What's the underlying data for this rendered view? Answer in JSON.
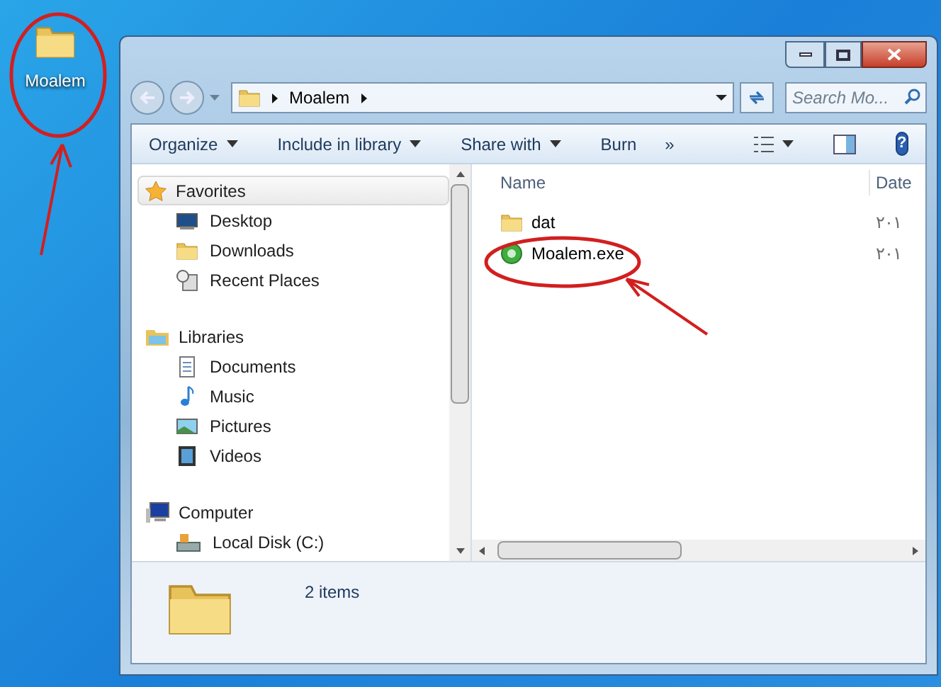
{
  "desktop_icons": [
    {
      "label": "Moalem",
      "kind": "folder"
    }
  ],
  "window": {
    "address": {
      "crumbs": [
        "Moalem"
      ]
    },
    "search": {
      "placeholder": "Search Mo..."
    },
    "toolbar": [
      {
        "label": "Organize",
        "dropdown": true
      },
      {
        "label": "Include in library",
        "dropdown": true
      },
      {
        "label": "Share with",
        "dropdown": true
      },
      {
        "label": "Burn",
        "dropdown": false
      }
    ],
    "toolbar_overflow": "»",
    "help": "?",
    "navigation": [
      {
        "label": "Favorites",
        "kind": "favorites",
        "selected": true,
        "children": [
          {
            "label": "Desktop",
            "kind": "desktop"
          },
          {
            "label": "Downloads",
            "kind": "folder"
          },
          {
            "label": "Recent Places",
            "kind": "recent"
          }
        ]
      },
      {
        "label": "Libraries",
        "kind": "libraries",
        "selected": false,
        "children": [
          {
            "label": "Documents",
            "kind": "documents"
          },
          {
            "label": "Music",
            "kind": "music"
          },
          {
            "label": "Pictures",
            "kind": "pictures"
          },
          {
            "label": "Videos",
            "kind": "videos"
          }
        ]
      },
      {
        "label": "Computer",
        "kind": "computer",
        "selected": false,
        "children": [
          {
            "label": "Local Disk (C:)",
            "kind": "disk"
          }
        ]
      }
    ],
    "columns": [
      "Name",
      "Date"
    ],
    "files": [
      {
        "name": "dat",
        "kind": "folder",
        "date": "٢٠١"
      },
      {
        "name": "Moalem.exe",
        "kind": "exe",
        "date": "٢٠١"
      }
    ],
    "details": {
      "text": "2 items"
    }
  }
}
